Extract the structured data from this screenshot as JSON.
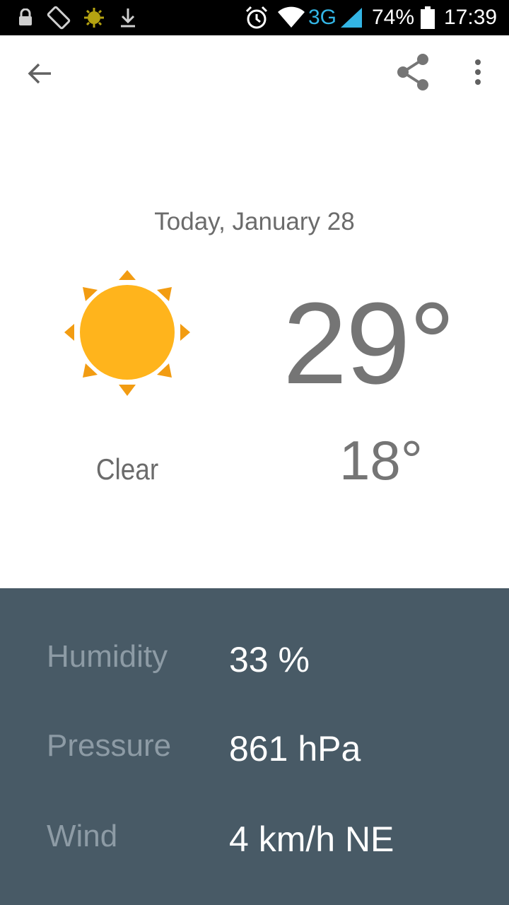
{
  "status_bar": {
    "network": "3G",
    "battery_percent": "74%",
    "time": "17:39",
    "icons": [
      "lock-icon",
      "screen-rotation-icon",
      "sun-notification-icon",
      "download-icon",
      "alarm-icon",
      "wifi-icon",
      "signal-icon",
      "battery-icon"
    ],
    "network_color": "#33b5e5"
  },
  "toolbar": {
    "icons": [
      "back-arrow-icon",
      "share-icon",
      "more-vert-icon"
    ]
  },
  "forecast": {
    "date": "Today, January 28",
    "high": "29°",
    "low": "18°",
    "condition": "Clear",
    "icon": "sun-icon",
    "icon_colors": {
      "sun": "#ffb41c",
      "rays": "#f29c12"
    }
  },
  "details": {
    "background": "#485a66",
    "rows": [
      {
        "label": "Humidity",
        "value": "33 %"
      },
      {
        "label": "Pressure",
        "value": "861 hPa"
      },
      {
        "label": "Wind",
        "value": "4 km/h NE"
      }
    ]
  }
}
